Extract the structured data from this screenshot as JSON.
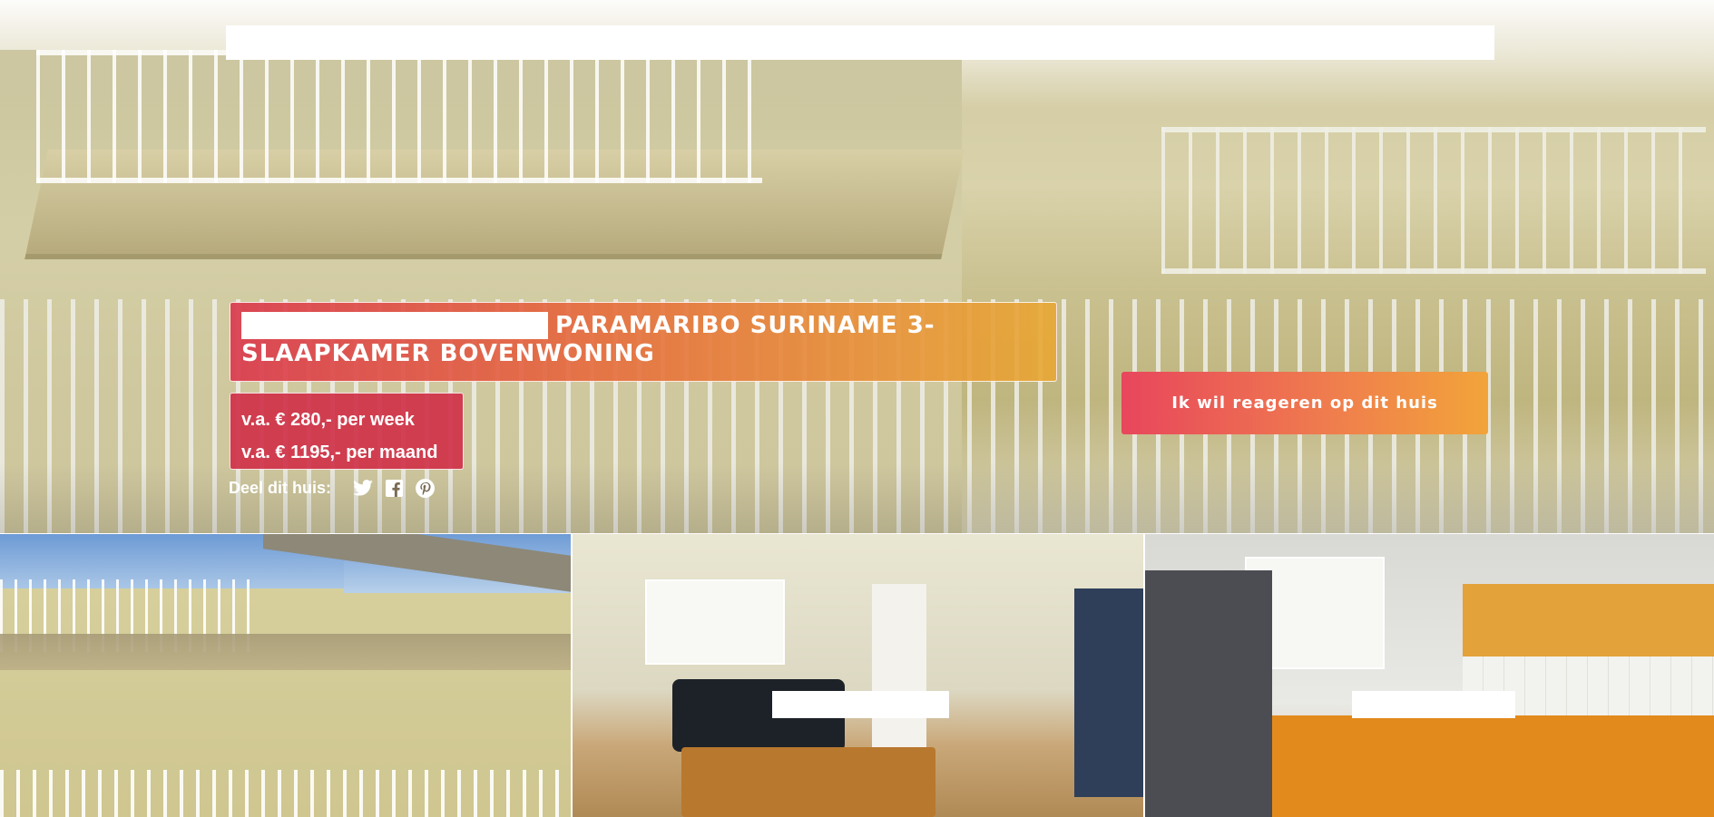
{
  "listing": {
    "title": "PARAMARIBO SURINAME 3-SLAAPKAMER BOVENWONING",
    "price_week": "v.a. € 280,- per week",
    "price_month": "v.a. € 1195,- per maand"
  },
  "share": {
    "label": "Deel dit huis:",
    "icons": [
      "twitter-icon",
      "facebook-icon",
      "pinterest-icon"
    ]
  },
  "cta": {
    "label": "Ik wil reageren op dit huis"
  },
  "colors": {
    "gradient_start": "#e8465c",
    "gradient_end": "#f2a43a",
    "price_bg": "#cf2d46"
  }
}
